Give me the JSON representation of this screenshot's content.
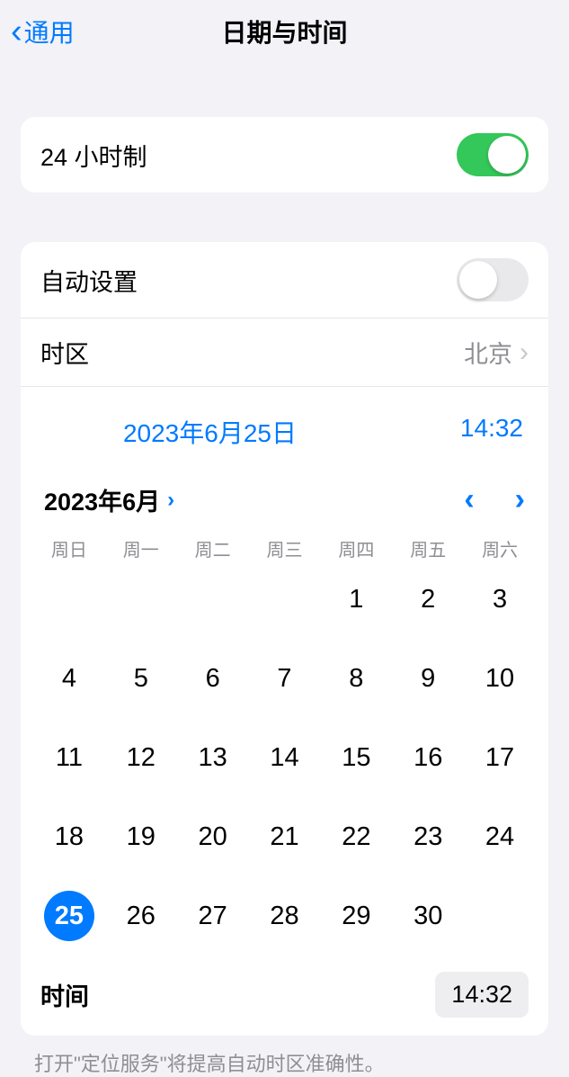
{
  "header": {
    "back": "通用",
    "title": "日期与时间"
  },
  "hour24": {
    "label": "24 小时制",
    "on": true
  },
  "autoset": {
    "label": "自动设置",
    "on": false
  },
  "timezone": {
    "label": "时区",
    "value": "北京"
  },
  "datetime": {
    "date": "2023年6月25日",
    "time": "14:32"
  },
  "calendar": {
    "month": "2023年6月",
    "weekdays": [
      "周日",
      "周一",
      "周二",
      "周三",
      "周四",
      "周五",
      "周六"
    ],
    "leading_blanks": 4,
    "days": 30,
    "selected": 25
  },
  "time_row": {
    "label": "时间",
    "value": "14:32"
  },
  "footer": "打开\"定位服务\"将提高自动时区准确性。"
}
